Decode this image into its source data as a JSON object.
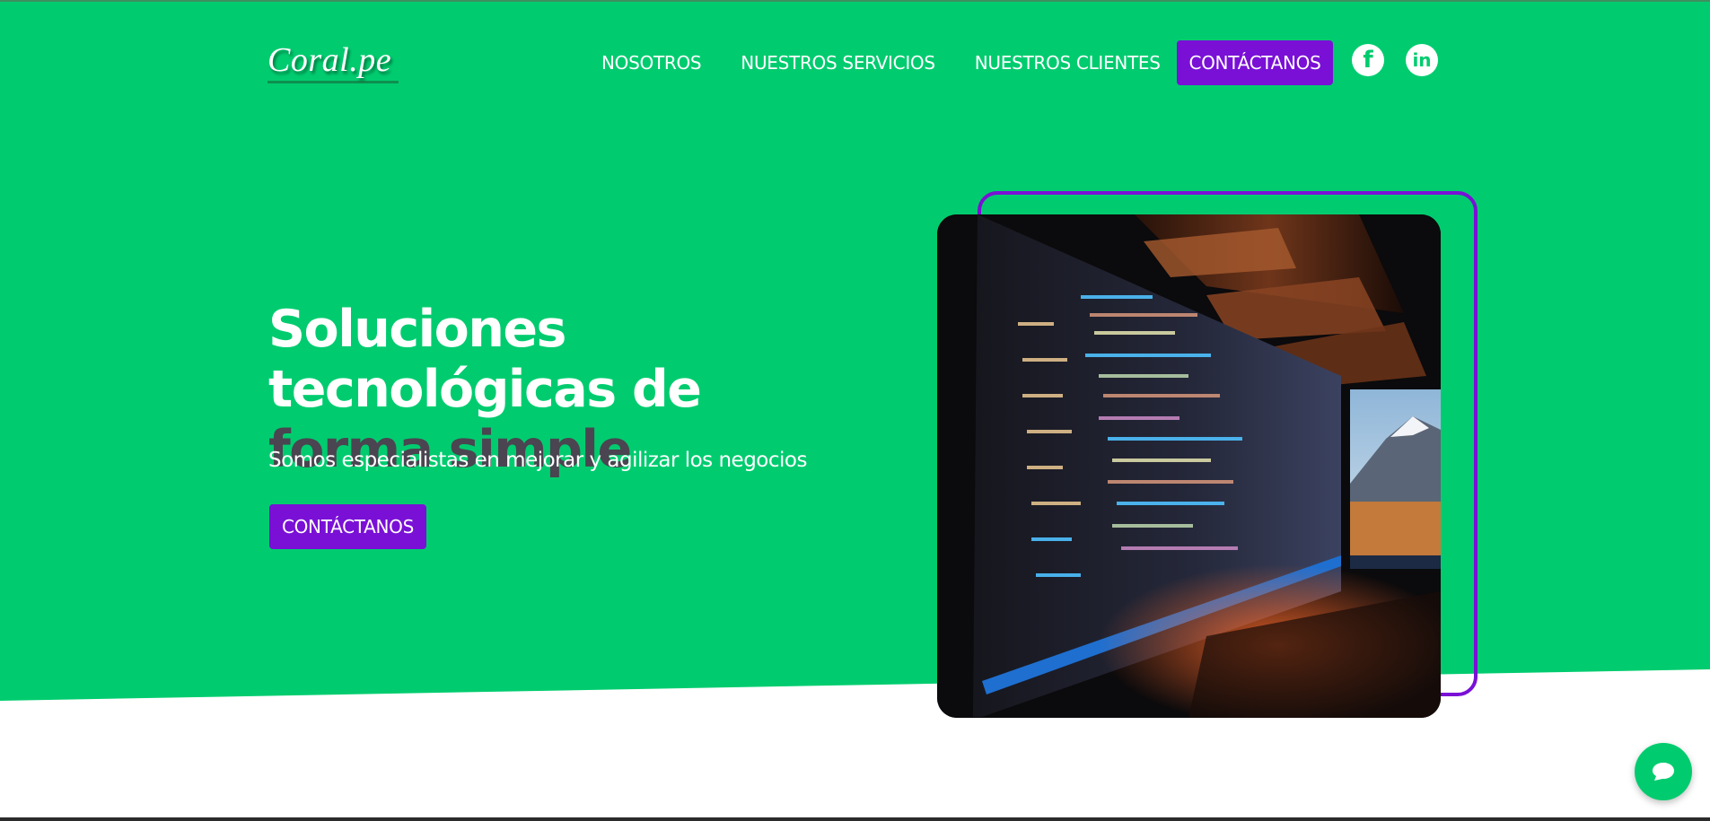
{
  "brand": {
    "logo_text": "Coral.pe"
  },
  "nav": {
    "items": [
      {
        "label": "NOSOTROS"
      },
      {
        "label": "NUESTROS SERVICIOS"
      },
      {
        "label": "NUESTROS CLIENTES"
      }
    ],
    "cta_label": "CONTÁCTANOS",
    "social": [
      {
        "icon": "facebook-icon",
        "glyph": "f"
      },
      {
        "icon": "linkedin-icon",
        "glyph": "in"
      }
    ]
  },
  "hero": {
    "headline_part1": "Soluciones tecnológicas de",
    "headline_part2": "forma simple",
    "subtitle": "Somos especialistas en mejorar y agilizar los negocios",
    "cta_label": "CONTÁCTANOS",
    "image_icon": "monitor-code-photo"
  },
  "chat": {
    "icon": "chat-bubble-icon"
  },
  "colors": {
    "brand_green": "#00cc6f",
    "accent_purple": "#7a10d6",
    "headline_dark": "#4a4550",
    "white": "#ffffff"
  }
}
